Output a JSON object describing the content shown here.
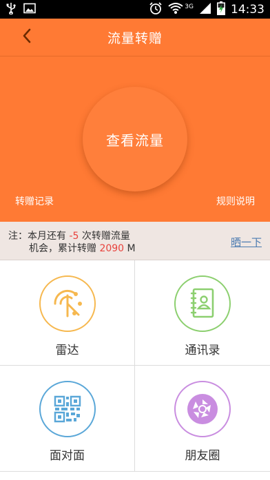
{
  "status_bar": {
    "time": "14:33",
    "network": "3G",
    "icons": [
      "usb-icon",
      "image-icon",
      "alarm-icon",
      "wifi-icon",
      "signal-icon",
      "battery-charging-icon"
    ]
  },
  "header": {
    "title": "流量转赠",
    "back_icon": "back-arrow-icon"
  },
  "hero": {
    "button_label": "查看流量",
    "left_link": "转赠记录",
    "right_link": "规则说明"
  },
  "notice": {
    "prefix": "注：本月还有 ",
    "count": "-5",
    "middle": " 次转赠流量",
    "line2_prefix": "机会，累计转赠 ",
    "total": "2090",
    "unit": " M",
    "share_label": "晒一下"
  },
  "grid": {
    "items": [
      {
        "label": "雷达",
        "icon": "radar-icon",
        "color": "#f6b84f"
      },
      {
        "label": "通讯录",
        "icon": "contacts-book-icon",
        "color": "#8ccf6f"
      },
      {
        "label": "面对面",
        "icon": "qr-code-icon",
        "color": "#5aa7d8"
      },
      {
        "label": "朋友圈",
        "icon": "aperture-icon",
        "color": "#c98de0"
      }
    ]
  },
  "colors": {
    "brand_orange": "#ff7a34",
    "notice_bg": "#efe6e2",
    "highlight_red": "#e8413c",
    "link_blue": "#4a7ab0"
  }
}
